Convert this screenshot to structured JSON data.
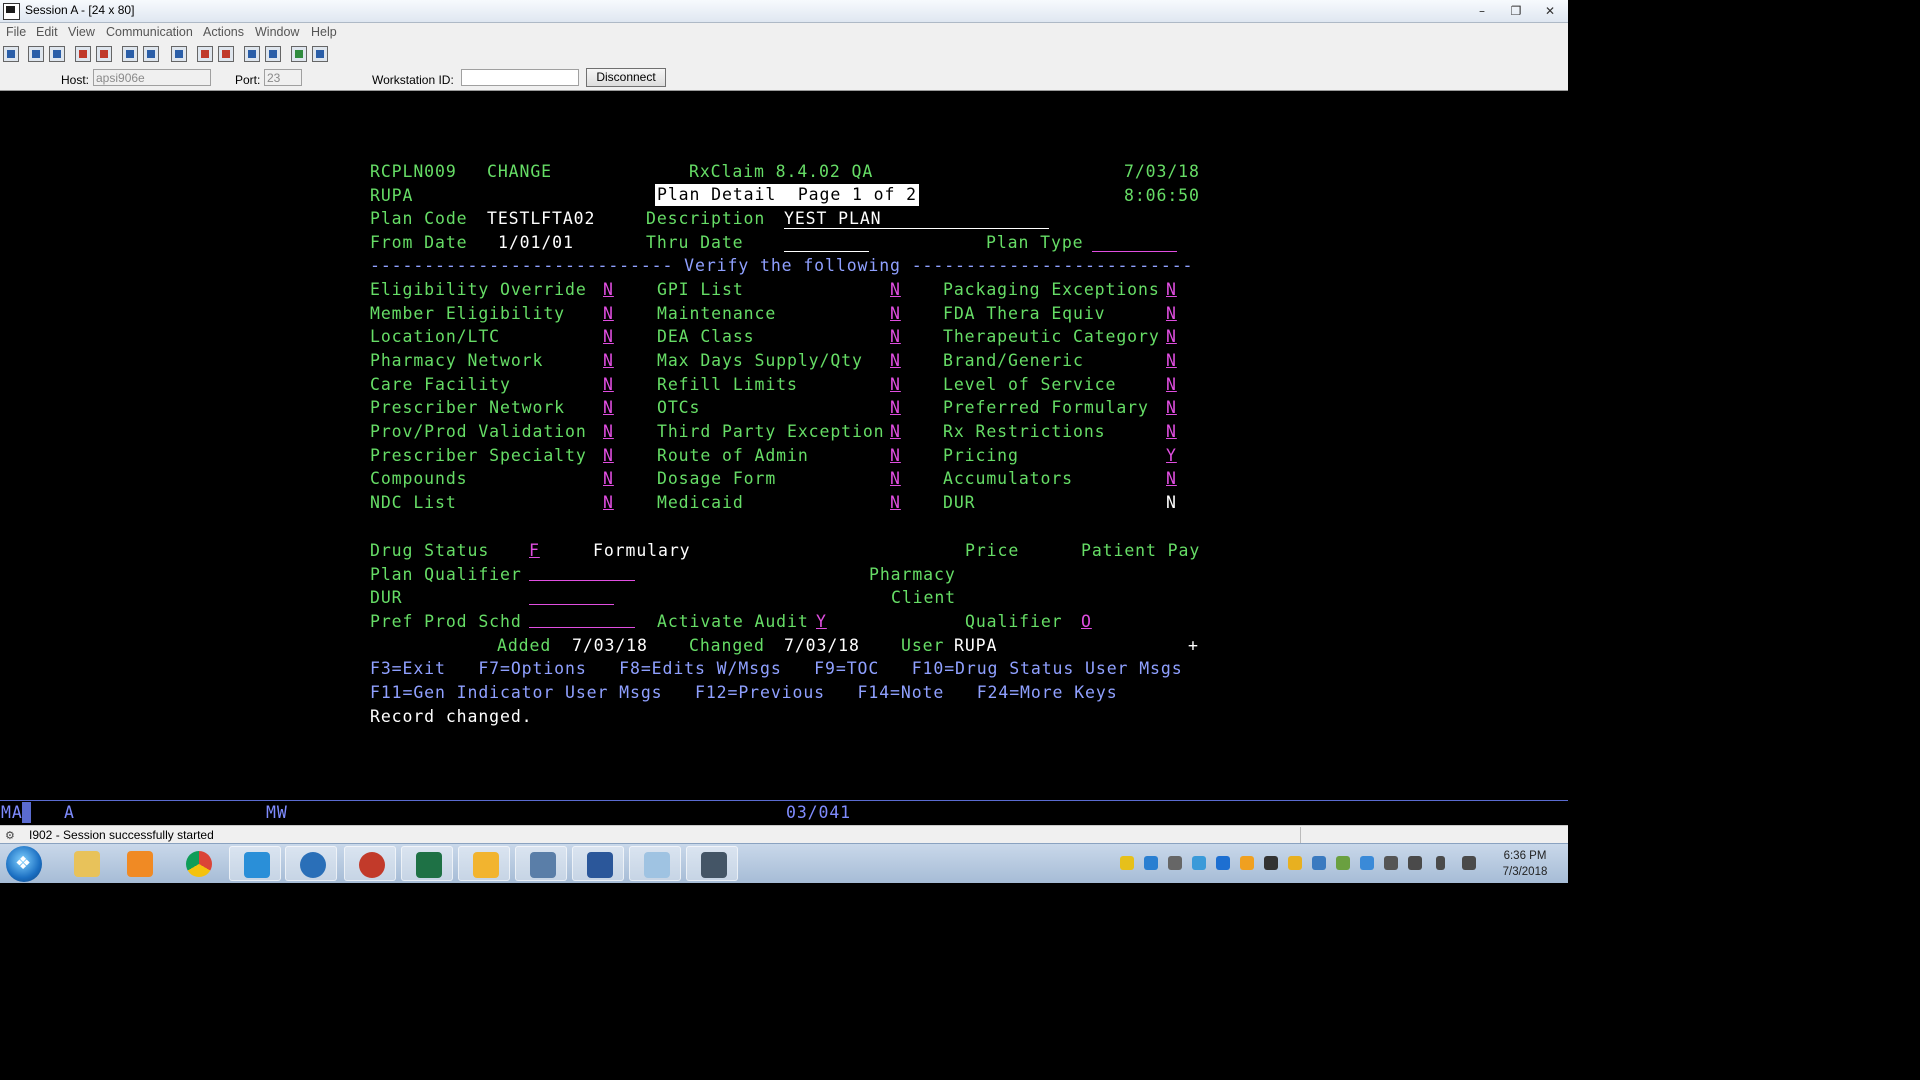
{
  "window": {
    "title": "Session A - [24 x 80]"
  },
  "menu": [
    "File",
    "Edit",
    "View",
    "Communication",
    "Actions",
    "Window",
    "Help"
  ],
  "hostbar": {
    "host_label": "Host:",
    "host_value": "apsi906e",
    "port_label": "Port:",
    "port_value": "23",
    "workstation_label": "Workstation ID:",
    "workstation_value": "",
    "disconnect_label": "Disconnect"
  },
  "screen": {
    "program": "RCPLN009",
    "mode": "CHANGE",
    "system": "RxClaim 8.4.02 QA",
    "date": "7/03/18",
    "user_id": "RUPA",
    "screen_title": "Plan Detail  Page 1 of 2",
    "time": "8:06:50",
    "plan_code_label": "Plan Code",
    "plan_code": "TESTLFTA02",
    "description_label": "Description",
    "description": "YEST PLAN",
    "from_date_label": "From Date",
    "from_date": "1/01/01",
    "thru_date_label": "Thru Date",
    "thru_date": "",
    "plan_type_label": "Plan Type",
    "plan_type": "",
    "verify_line": "---------------------------- Verify the following --------------------------",
    "col1": [
      {
        "label": "Eligibility Override",
        "value": "N"
      },
      {
        "label": "Member Eligibility",
        "value": "N"
      },
      {
        "label": "Location/LTC",
        "value": "N"
      },
      {
        "label": "Pharmacy Network",
        "value": "N"
      },
      {
        "label": "Care Facility",
        "value": "N"
      },
      {
        "label": "Prescriber Network",
        "value": "N"
      },
      {
        "label": "Prov/Prod Validation",
        "value": "N"
      },
      {
        "label": "Prescriber Specialty",
        "value": "N"
      },
      {
        "label": "Compounds",
        "value": "N"
      },
      {
        "label": "NDC List",
        "value": "N"
      }
    ],
    "col2": [
      {
        "label": "GPI List",
        "value": "N"
      },
      {
        "label": "Maintenance",
        "value": "N"
      },
      {
        "label": "DEA Class",
        "value": "N"
      },
      {
        "label": "Max Days Supply/Qty",
        "value": "N"
      },
      {
        "label": "Refill Limits",
        "value": "N"
      },
      {
        "label": "OTCs",
        "value": "N"
      },
      {
        "label": "Third Party Exception",
        "value": "N"
      },
      {
        "label": "Route of Admin",
        "value": "N"
      },
      {
        "label": "Dosage Form",
        "value": "N"
      },
      {
        "label": "Medicaid",
        "value": "N"
      }
    ],
    "col3": [
      {
        "label": "Packaging Exceptions",
        "value": "N"
      },
      {
        "label": "FDA Thera Equiv",
        "value": "N"
      },
      {
        "label": "Therapeutic Category",
        "value": "N"
      },
      {
        "label": "Brand/Generic",
        "value": "N"
      },
      {
        "label": "Level of Service",
        "value": "N"
      },
      {
        "label": "Preferred Formulary",
        "value": "N"
      },
      {
        "label": "Rx Restrictions",
        "value": "N"
      },
      {
        "label": "Pricing",
        "value": "Y"
      },
      {
        "label": "Accumulators",
        "value": "N"
      },
      {
        "label": "DUR",
        "value": "N"
      }
    ],
    "drug_status_label": "Drug Status",
    "drug_status": "F",
    "drug_status_desc": "Formulary",
    "price_label": "Price",
    "patient_pay_label": "Patient Pay",
    "plan_qualifier_label": "Plan Qualifier",
    "plan_qualifier": "",
    "pharmacy_label": "Pharmacy",
    "dur_label": "DUR",
    "dur_value": "",
    "client_label": "Client",
    "pref_prod_label": "Pref Prod Schd",
    "pref_prod_value": "",
    "activate_audit_label": "Activate Audit",
    "activate_audit": "Y",
    "qualifier_label": "Qualifier",
    "qualifier": "O",
    "added_label": "Added",
    "added": "7/03/18",
    "changed_label": "Changed",
    "changed": "7/03/18",
    "user_label": "User",
    "user": "RUPA",
    "more": "+",
    "fkeys1": "F3=Exit   F7=Options   F8=Edits W/Msgs   F9=TOC   F10=Drug Status User Msgs",
    "fkeys2": "F11=Gen Indicator User Msgs   F12=Previous   F14=Note   F24=More Keys",
    "message": "Record changed."
  },
  "oia": {
    "ma": "MA",
    "a": "A",
    "mw": "MW",
    "cursor": "03/041"
  },
  "status": {
    "message": "I902 - Session successfully started"
  },
  "taskbar": {
    "apps": [
      "file-explorer",
      "media-player",
      "chrome",
      "internet-explorer",
      "thunderbird",
      "ibm-notes",
      "excel",
      "outlook",
      "monitor-app",
      "word",
      "notepad",
      "host-on-demand"
    ],
    "time": "6:36 PM",
    "date": "7/3/2018"
  }
}
